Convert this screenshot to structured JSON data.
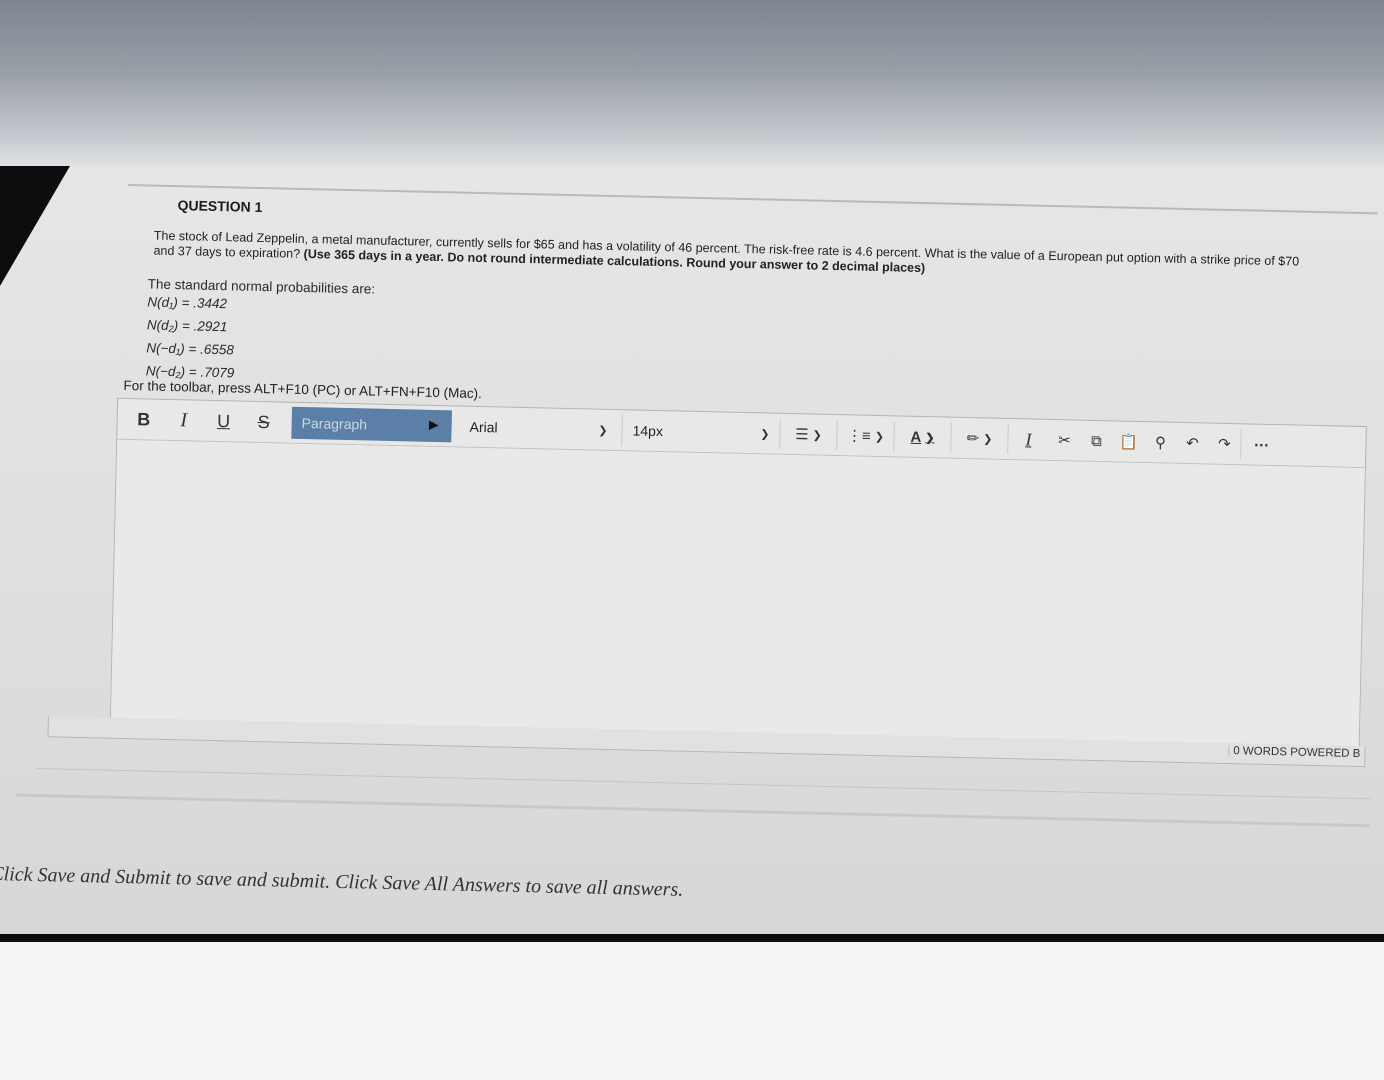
{
  "question": {
    "title": "QUESTION 1",
    "text_plain": "The stock of Lead Zeppelin, a metal manufacturer, currently sells for $65 and has a volatility of 46 percent. The risk-free rate is 4.6 percent. What is the value of a European put option with a strike price of $70 and 37 days to expiration?",
    "text_bold": "(Use 365 days in a year. Do not round intermediate calculations. Round your answer to 2 decimal places)",
    "probabilities_label": "The standard normal probabilities are:",
    "probabilities": [
      "N(d₁) = .3442",
      "N(d₂) = .2921",
      "N(−d₁) = .6558",
      "N(−d₂) = .7079"
    ]
  },
  "editor": {
    "toolbar_hint": "For the toolbar, press ALT+F10 (PC) or ALT+FN+F10 (Mac).",
    "bold": "B",
    "italic": "I",
    "underline": "U",
    "strikethrough": "S",
    "paragraph": "Paragraph",
    "font": "Arial",
    "size": "14px",
    "word_count": "0 WORDS",
    "powered_by": "POWERED B"
  },
  "footer": {
    "note": "Click Save and Submit to save and submit. Click Save All Answers to save all answers."
  }
}
